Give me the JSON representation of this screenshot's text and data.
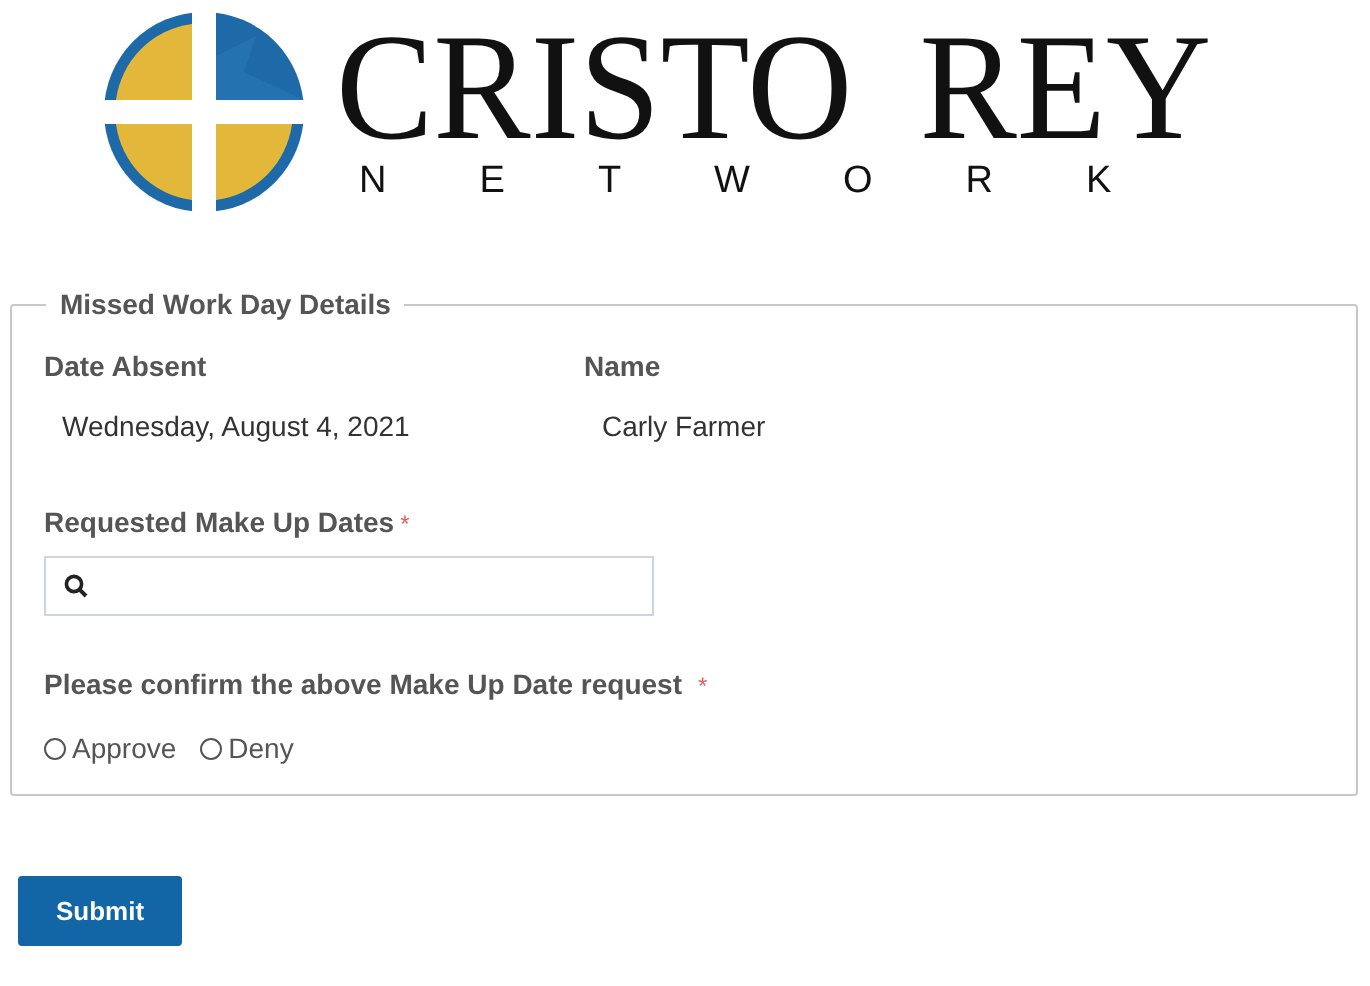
{
  "logo": {
    "title": "CRISTO REY",
    "subtitle": "NETWORK"
  },
  "details": {
    "legend": "Missed Work Day Details",
    "fields": [
      {
        "label": "Date Absent",
        "value": "Wednesday, August 4, 2021"
      },
      {
        "label": "Name",
        "value": "Carly Farmer"
      }
    ],
    "search": {
      "label": "Requested Make Up Dates",
      "required_mark": "*"
    },
    "confirm": {
      "label": "Please confirm the above Make Up Date request",
      "required_mark": "*",
      "options": [
        {
          "label": "Approve",
          "selected": false
        },
        {
          "label": "Deny",
          "selected": false
        }
      ]
    }
  },
  "submit": "Submit"
}
